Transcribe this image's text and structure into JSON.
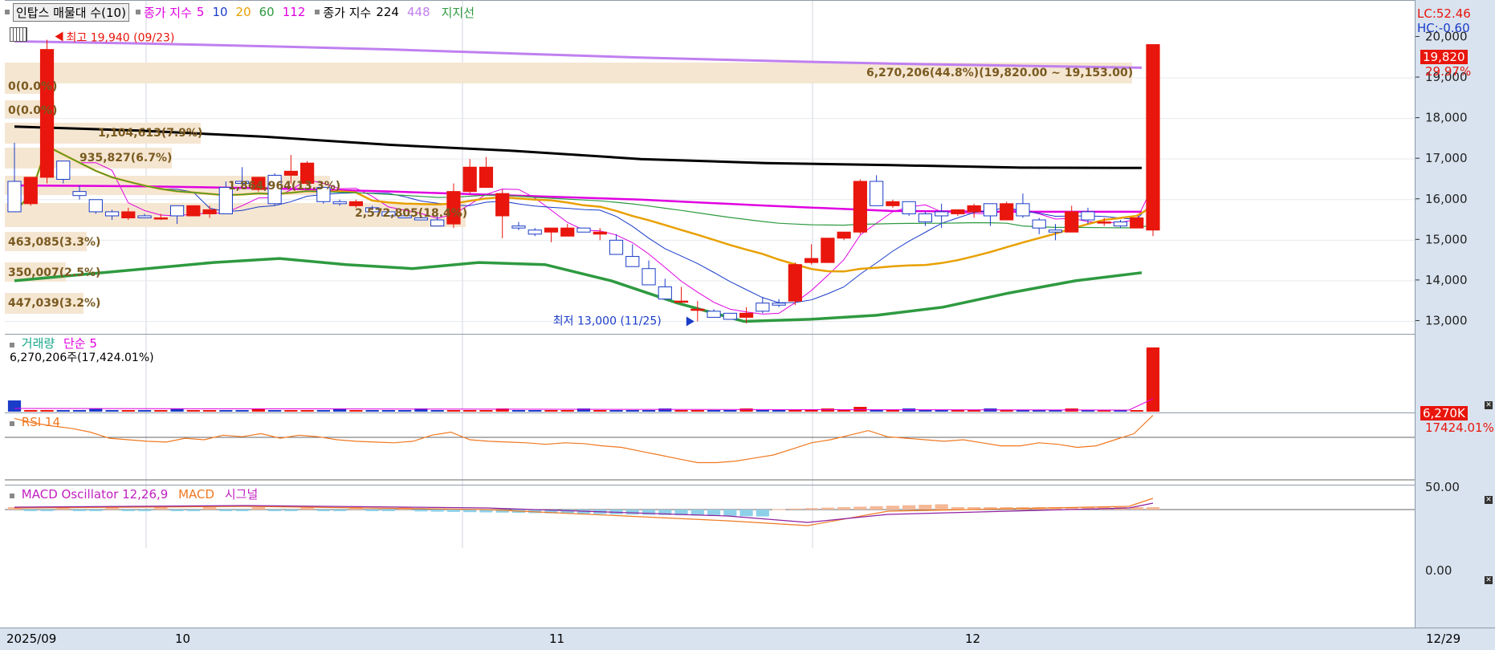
{
  "header": {
    "title": "인탑스 매물대 수(10)",
    "ma_label": "종가 지수",
    "ma_periods": [
      {
        "label": "5",
        "color": "#e000e0"
      },
      {
        "label": "10",
        "color": "#1a3cc8"
      },
      {
        "label": "20",
        "color": "#e8a000"
      },
      {
        "label": "60",
        "color": "#2e9a40"
      },
      {
        "label": "112",
        "color": "#e000e0"
      }
    ],
    "ma2_label": "종가 지수",
    "ma2_periods": [
      {
        "label": "224",
        "color": "#000000"
      },
      {
        "label": "448",
        "color": "#c080f0"
      }
    ],
    "support_label": "지지선",
    "colors": {
      "up": "#e8160c",
      "down": "#1a3cc8",
      "volume_zone": "#f5e6d2"
    }
  },
  "price_pane": {
    "high_note": "최고 19,940 (09/23)",
    "low_note": "최저 13,000 (11/25)",
    "volume_zones": [
      {
        "label": "6,270,206(44.8%)(19,820.00 ~ 19,153.00)"
      },
      {
        "label": "0(0.0%)"
      },
      {
        "label": "0(0.0%)"
      },
      {
        "label": "1,104,613(7.9%)"
      },
      {
        "label": "935,827(6.7%)"
      },
      {
        "label": "1,864,964(13.3%)"
      },
      {
        "label": "2,572,805(18.4%)"
      },
      {
        "label": "463,085(3.3%)"
      },
      {
        "label": "350,007(2.5%)"
      },
      {
        "label": "447,039(3.2%)"
      }
    ],
    "right_labels": {
      "lc": "LC:52.46",
      "hc": "HC:-0.60",
      "last_price": "19,820",
      "last_change": "29.97%"
    }
  },
  "volume_pane": {
    "title": "거래량",
    "ma_label": "단순 5",
    "value": "6,270,206주(17,424.01%)",
    "tag": "6,270K",
    "tag_change": "17424.01%"
  },
  "rsi_pane": {
    "title": "RSI 14"
  },
  "macd_pane": {
    "title": "MACD Oscillator 12,26,9",
    "macd_label": "MACD",
    "signal_label": "시그널"
  },
  "x_axis": {
    "labels": [
      "2025/09",
      "10",
      "11",
      "12",
      "12/29"
    ]
  },
  "chart_data": {
    "type": "candlestick",
    "period": "daily",
    "x_range": [
      "2025-09",
      "2025-12-29"
    ],
    "ylim": [
      12800,
      20200
    ],
    "y_ticks": [
      13000,
      14000,
      15000,
      16000,
      17000,
      18000,
      19000,
      20000
    ],
    "y_tick_labels": [
      "13,000",
      "14,000",
      "15,000",
      "16,000",
      "17,000",
      "18,000",
      "19,000",
      "20,000"
    ],
    "high": {
      "value": 19940,
      "date": "09/23"
    },
    "low": {
      "value": 13000,
      "date": "11/25"
    },
    "ohlc": [
      [
        16450,
        17400,
        15950,
        15700
      ],
      [
        15900,
        16550,
        15850,
        16550
      ],
      [
        16550,
        19940,
        16400,
        19700
      ],
      [
        16950,
        16950,
        16400,
        16500
      ],
      [
        16200,
        16350,
        16000,
        16100
      ],
      [
        16000,
        16000,
        15650,
        15700
      ],
      [
        15700,
        15750,
        15500,
        15600
      ],
      [
        15550,
        15800,
        15500,
        15700
      ],
      [
        15600,
        15650,
        15550,
        15550
      ],
      [
        15550,
        15650,
        15500,
        15550
      ],
      [
        15850,
        15850,
        15400,
        15600
      ],
      [
        15600,
        15850,
        15600,
        15850
      ],
      [
        15650,
        15850,
        15550,
        15750
      ],
      [
        16300,
        16450,
        15650,
        15650
      ],
      [
        16450,
        16800,
        16350,
        16400
      ],
      [
        16250,
        16550,
        16200,
        16550
      ],
      [
        16600,
        16650,
        15850,
        15900
      ],
      [
        16600,
        17100,
        16400,
        16700
      ],
      [
        16400,
        16950,
        16350,
        16900
      ],
      [
        16300,
        16300,
        15900,
        15950
      ],
      [
        15950,
        16000,
        15850,
        15900
      ],
      [
        15850,
        16000,
        15800,
        15950
      ],
      [
        15800,
        15850,
        15700,
        15700
      ],
      [
        15700,
        15700,
        15600,
        15600
      ],
      [
        15600,
        15650,
        15550,
        15550
      ],
      [
        15550,
        15600,
        15500,
        15500
      ],
      [
        15500,
        15600,
        15350,
        15350
      ],
      [
        15400,
        16400,
        15300,
        16200
      ],
      [
        16200,
        17000,
        16150,
        16800
      ],
      [
        16300,
        17050,
        16300,
        16800
      ],
      [
        15600,
        16250,
        15050,
        16150
      ],
      [
        15350,
        15450,
        15250,
        15300
      ],
      [
        15250,
        15300,
        15100,
        15150
      ],
      [
        15200,
        15250,
        14950,
        15300
      ],
      [
        15100,
        15400,
        15100,
        15300
      ],
      [
        15300,
        15300,
        15200,
        15200
      ],
      [
        15150,
        15300,
        15000,
        15200
      ],
      [
        15000,
        15150,
        14700,
        14650
      ],
      [
        14600,
        14900,
        14400,
        14350
      ],
      [
        14300,
        14500,
        13900,
        13900
      ],
      [
        13850,
        14050,
        13550,
        13550
      ],
      [
        13500,
        13850,
        13450,
        13500
      ],
      [
        13300,
        13500,
        13000,
        13300
      ],
      [
        13250,
        13300,
        13150,
        13100
      ],
      [
        13200,
        13200,
        13050,
        13050
      ],
      [
        13100,
        13350,
        12950,
        13200
      ],
      [
        13450,
        13600,
        13200,
        13250
      ],
      [
        13450,
        13550,
        13350,
        13400
      ],
      [
        13500,
        14450,
        13400,
        14400
      ],
      [
        14450,
        14900,
        14400,
        14550
      ],
      [
        14450,
        15050,
        14450,
        15050
      ],
      [
        15050,
        15200,
        15000,
        15200
      ],
      [
        15200,
        16500,
        15150,
        16450
      ],
      [
        16450,
        16600,
        15850,
        15850
      ],
      [
        15850,
        16000,
        15800,
        15950
      ],
      [
        15950,
        15950,
        15600,
        15650
      ],
      [
        15650,
        15700,
        15350,
        15450
      ],
      [
        15700,
        15900,
        15300,
        15600
      ],
      [
        15650,
        15750,
        15600,
        15750
      ],
      [
        15700,
        15900,
        15550,
        15850
      ],
      [
        15900,
        15900,
        15350,
        15600
      ],
      [
        15500,
        15950,
        15500,
        15900
      ],
      [
        15900,
        16150,
        15550,
        15600
      ],
      [
        15500,
        15550,
        15150,
        15300
      ],
      [
        15250,
        15400,
        15000,
        15200
      ],
      [
        15200,
        15850,
        15200,
        15700
      ],
      [
        15700,
        15800,
        15400,
        15500
      ],
      [
        15450,
        15550,
        15350,
        15450
      ],
      [
        15450,
        15500,
        15300,
        15350
      ],
      [
        15300,
        15550,
        15300,
        15550
      ],
      [
        15250,
        19820,
        15100,
        19820
      ]
    ],
    "ma": [
      {
        "name": "224",
        "color": "#000000",
        "values": [
          17800,
          17700,
          17550,
          17350,
          17200,
          17000,
          16900,
          16850,
          16790,
          16780
        ]
      },
      {
        "name": "448",
        "color": "#c080f0",
        "values": [
          19900,
          19850,
          19780,
          19700,
          19600,
          19500,
          19420,
          19350,
          19300,
          19250
        ]
      },
      {
        "name": "112",
        "color": "#e000e0",
        "values": [
          16350,
          16330,
          16280,
          16200,
          16100,
          16000,
          15850,
          15720,
          15700,
          15700
        ]
      }
    ]
  }
}
